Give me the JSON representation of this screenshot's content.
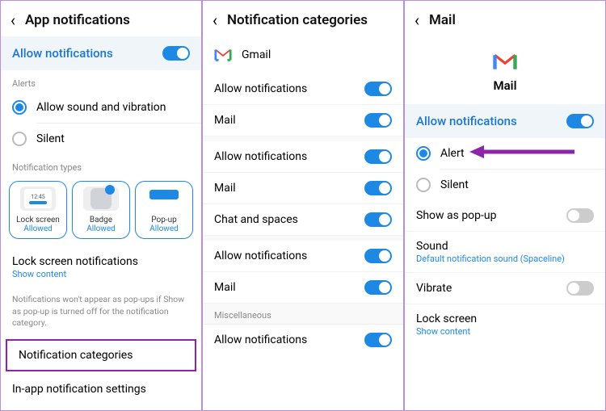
{
  "screen1": {
    "header": "App notifications",
    "allow": "Allow notifications",
    "alerts_label": "Alerts",
    "sound_vib": "Allow sound and vibration",
    "silent": "Silent",
    "types_label": "Notification types",
    "lock_time": "12:45",
    "type_lock": "Lock screen",
    "type_badge": "Badge",
    "type_popup": "Pop-up",
    "allowed": "Allowed",
    "lock_notif": "Lock screen notifications",
    "lock_notif_sub": "Show content",
    "help": "Notifications won't appear as pop-ups if Show as pop-up is turned off for the notification category.",
    "categories": "Notification categories",
    "inapp": "In-app notification settings"
  },
  "screen2": {
    "header": "Notification categories",
    "app": "Gmail",
    "rows": {
      "allow1": "Allow notifications",
      "mail1": "Mail",
      "allow2": "Allow notifications",
      "mail2": "Mail",
      "chat": "Chat and spaces",
      "allow3": "Allow notifications",
      "mail3": "Mail",
      "misc": "Miscellaneous",
      "allow4": "Allow notifications"
    }
  },
  "screen3": {
    "header": "Mail",
    "app": "Mail",
    "allow": "Allow notifications",
    "alert": "Alert",
    "silent": "Silent",
    "popup": "Show as pop-up",
    "sound": "Sound",
    "sound_sub": "Default notification sound (Spaceline)",
    "vibrate": "Vibrate",
    "lock": "Lock screen",
    "lock_sub": "Show content"
  }
}
